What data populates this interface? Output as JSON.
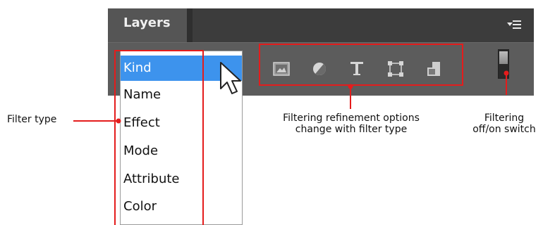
{
  "panel": {
    "tab_title": "Layers",
    "menu_icon": "panel-menu-icon",
    "filter_icons": [
      "pixel-layer-filter-icon",
      "adjustment-layer-filter-icon",
      "type-layer-filter-icon",
      "shape-layer-filter-icon",
      "smart-object-filter-icon"
    ],
    "switch_icon": "filter-toggle-switch"
  },
  "dropdown": {
    "items": [
      "Kind",
      "Name",
      "Effect",
      "Mode",
      "Attribute",
      "Color"
    ],
    "selected_index": 0
  },
  "annotations": {
    "filter_type": "Filter type",
    "refinement_line1": "Filtering refinement options",
    "refinement_line2": "change with filter type",
    "switch_line1": "Filtering",
    "switch_line2": "off/on switch"
  },
  "colors": {
    "highlight": "#e41c1c",
    "selection": "#3d93ed",
    "panel": "#5a5a5a"
  }
}
